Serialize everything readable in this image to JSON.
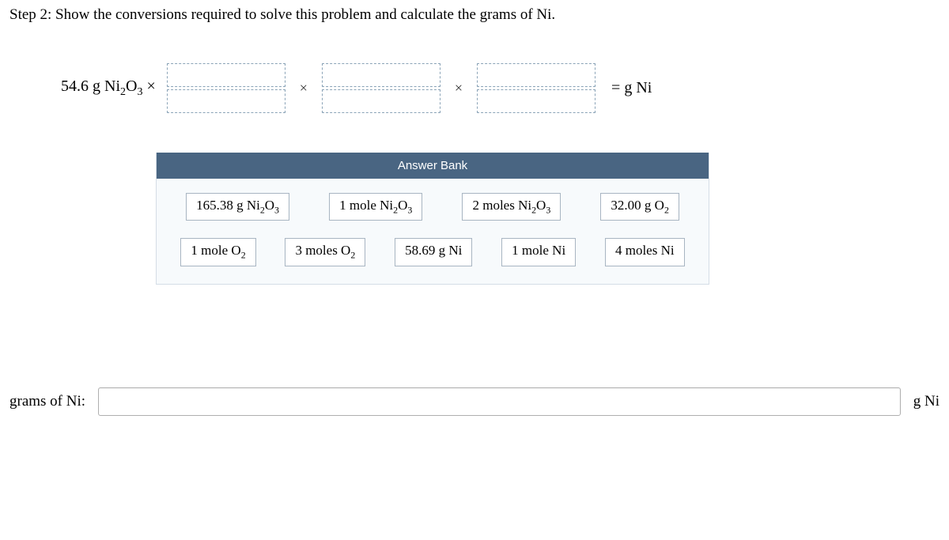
{
  "step_heading": "Step 2: Show the conversions required to solve this problem and calculate the grams of Ni.",
  "equation": {
    "leading_html": "54.6 g Ni<sub class='sub'>2</sub>O<sub class='sub'>3</sub> ×",
    "times": "×",
    "result": "=  g Ni"
  },
  "answer_bank": {
    "title": "Answer Bank",
    "rows": [
      [
        {
          "name": "tile-165.38g-ni2o3",
          "html": "165.38 g Ni<sub class='sub'>2</sub>O<sub class='sub'>3</sub>"
        },
        {
          "name": "tile-1mole-ni2o3",
          "html": "1 mole Ni<sub class='sub'>2</sub>O<sub class='sub'>3</sub>"
        },
        {
          "name": "tile-2moles-ni2o3",
          "html": "2 moles Ni<sub class='sub'>2</sub>O<sub class='sub'>3</sub>"
        },
        {
          "name": "tile-32.00g-o2",
          "html": "32.00 g O<sub class='sub'>2</sub>"
        }
      ],
      [
        {
          "name": "tile-1mole-o2",
          "html": "1 mole O<sub class='sub'>2</sub>"
        },
        {
          "name": "tile-3moles-o2",
          "html": "3 moles O<sub class='sub'>2</sub>"
        },
        {
          "name": "tile-58.69g-ni",
          "html": "58.69 g Ni"
        },
        {
          "name": "tile-1mole-ni",
          "html": "1 mole Ni"
        },
        {
          "name": "tile-4moles-ni",
          "html": "4 moles Ni"
        }
      ]
    ]
  },
  "final": {
    "label": "grams of Ni:",
    "value": "",
    "unit": "g Ni"
  }
}
